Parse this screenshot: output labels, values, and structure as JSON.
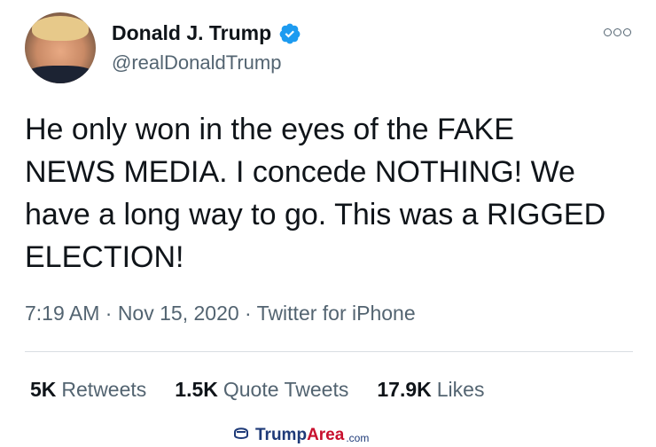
{
  "author": {
    "name": "Donald J. Trump",
    "handle": "@realDonaldTrump",
    "verified": true
  },
  "tweet": {
    "text": "He only won in the eyes of the FAKE\nNEWS MEDIA. I concede NOTHING! We\nhave a long way to go. This was a RIGGED\nELECTION!",
    "meta": "7:19 AM · Nov 15, 2020 · Twitter for iPhone"
  },
  "stats": [
    {
      "count": "5K",
      "label": "Retweets"
    },
    {
      "count": "1.5K",
      "label": "Quote Tweets"
    },
    {
      "count": "17.9K",
      "label": "Likes"
    }
  ],
  "watermark": {
    "part1": "Trump",
    "part2": "Area",
    "part3": ".com"
  },
  "colors": {
    "verified": "#1d9bf0",
    "text": "#0f1419",
    "secondary": "#536471"
  },
  "icons": {
    "verified": "verified-badge-icon",
    "more": "more-options-icon"
  }
}
